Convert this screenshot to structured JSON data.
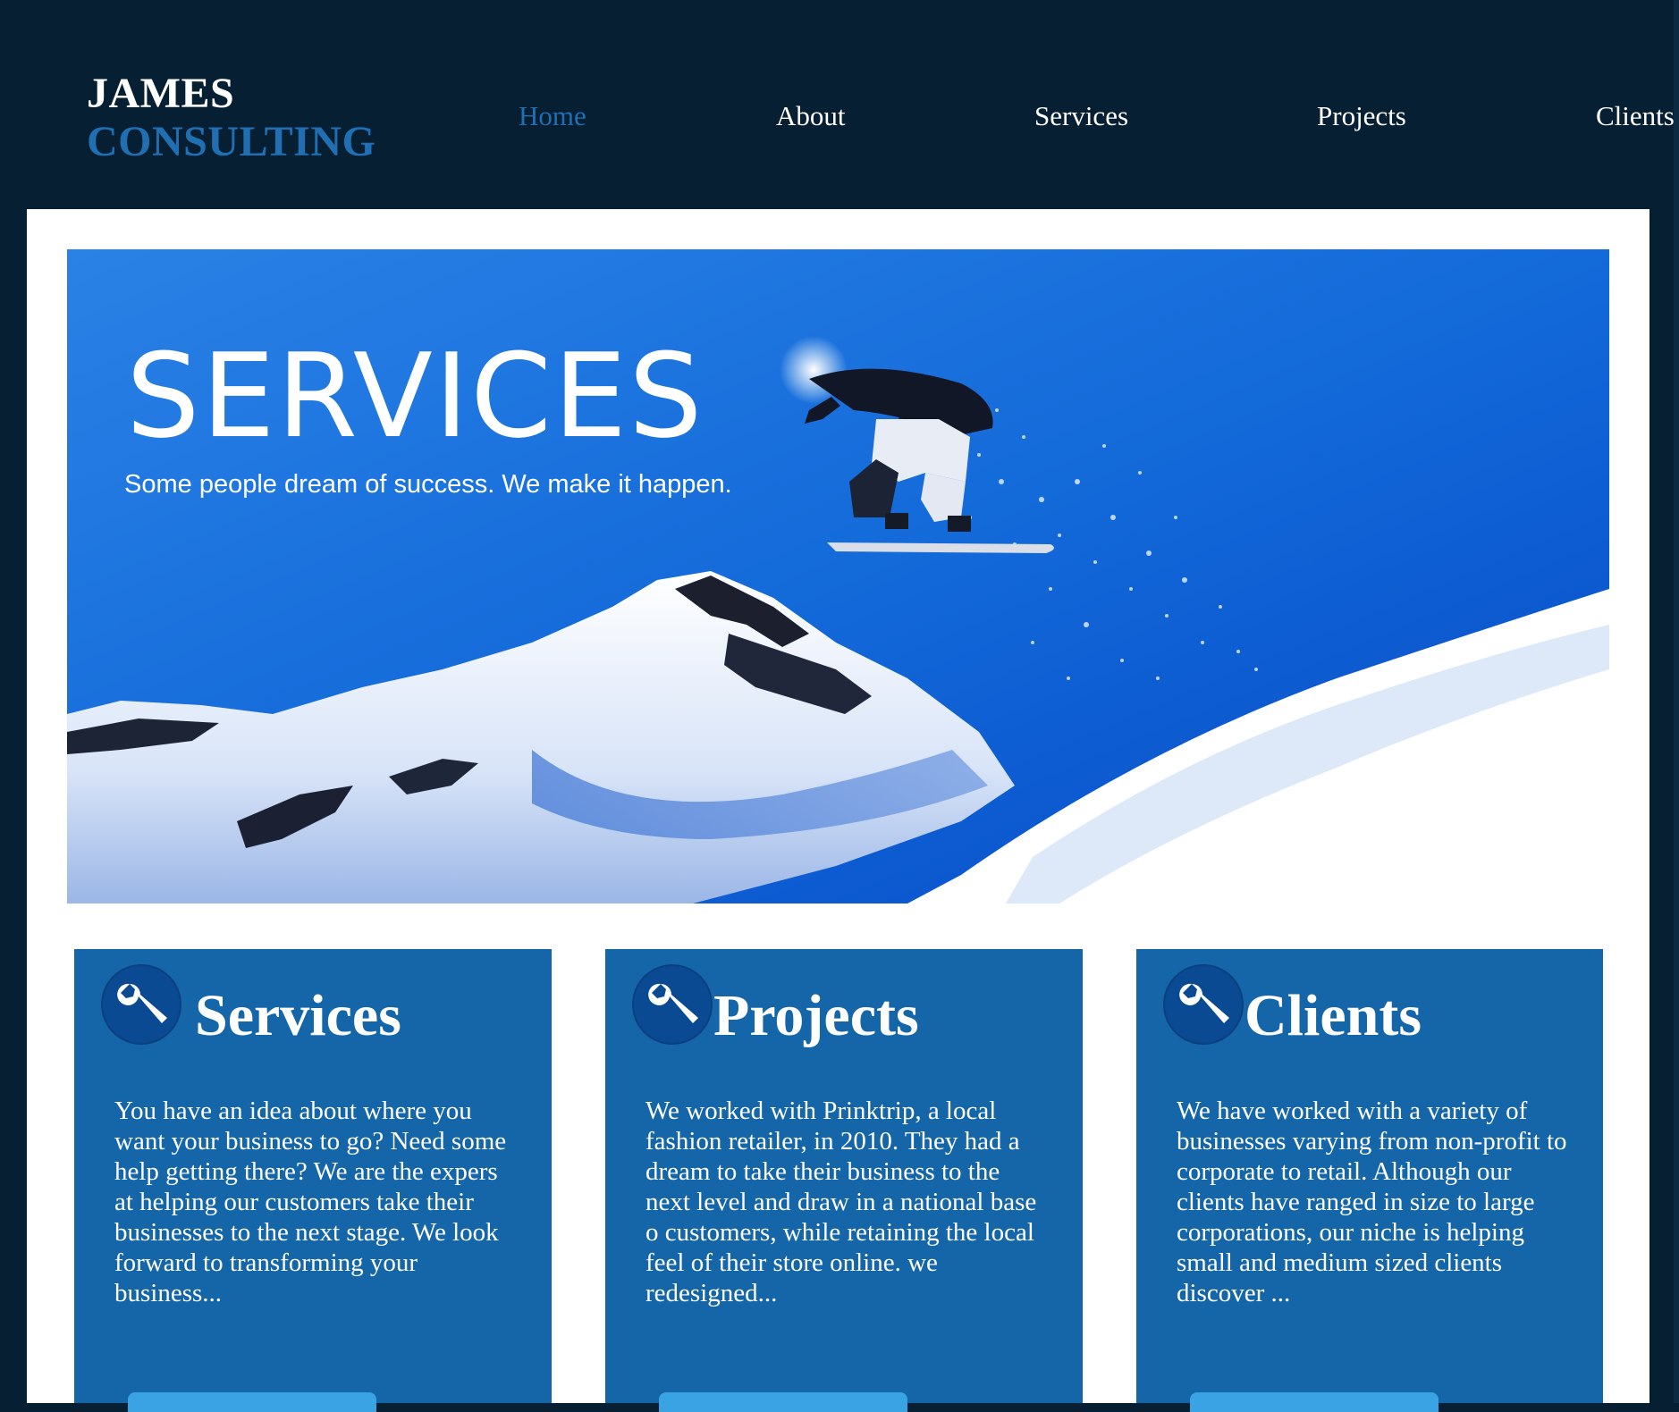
{
  "brand": {
    "line1": "JAMES",
    "line2": "CONSULTING"
  },
  "nav": {
    "items": [
      {
        "label": "Home",
        "active": true
      },
      {
        "label": "About",
        "active": false
      },
      {
        "label": "Services",
        "active": false
      },
      {
        "label": "Projects",
        "active": false
      },
      {
        "label": "Clients",
        "active": false
      }
    ]
  },
  "hero": {
    "title": "SERVICES",
    "subtitle": "Some people dream of success. We make it happen."
  },
  "cards": [
    {
      "icon": "wrench-icon",
      "title": "Services",
      "text": "You have an idea about where you want your business to go? Need some help getting there? We are the expers at helping our customers take their businesses to the next stage. We look forward to transforming your business..."
    },
    {
      "icon": "wrench-icon",
      "title": "Projects",
      "text": "We worked with Prinktrip, a local fashion retailer, in 2010. They had a dream to take their business to the next level and draw in a national base o customers, while retaining the local feel of their store online. we redesigned..."
    },
    {
      "icon": "wrench-icon",
      "title": "Clients",
      "text": "We have worked with a variety of businesses varying from non-profit to corporate to retail. Although our clients have ranged in size to large corporations, our niche is helping small and medium sized clients discover ..."
    }
  ],
  "colors": {
    "background": "#071f33",
    "accent": "#1f6fb2",
    "card": "#1566a9",
    "button": "#3aa3e3"
  }
}
